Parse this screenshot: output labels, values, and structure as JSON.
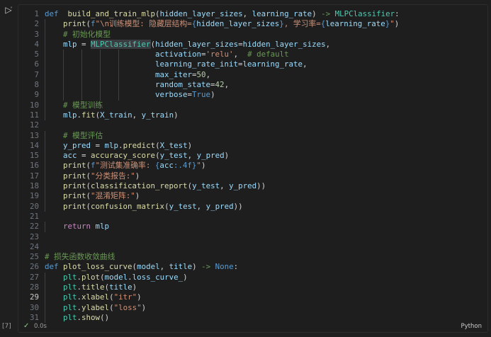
{
  "cell": {
    "run_icon": "run-icon",
    "run_glyph": "▷",
    "chevron_glyph": "˅",
    "execution_count": "[7]",
    "status_check": "✓",
    "exec_time": "0.0s",
    "language": "Python",
    "active_line": 29
  },
  "code_lines": [
    {
      "n": "1",
      "tokens": [
        [
          "kw",
          "def"
        ],
        [
          "",
          "  "
        ],
        [
          "fn",
          "build_and_train_mlp"
        ],
        [
          "",
          "("
        ],
        [
          "var",
          "hidden_layer_sizes"
        ],
        [
          "",
          ", "
        ],
        [
          "var",
          "learning_rate"
        ],
        [
          "",
          ") "
        ],
        [
          "cmt2",
          "->"
        ],
        [
          "",
          " "
        ],
        [
          "cls",
          "MLPClassifier"
        ],
        [
          "",
          ":"
        ]
      ]
    },
    {
      "n": "2",
      "tokens": [
        [
          "",
          "    "
        ],
        [
          "fn",
          "print"
        ],
        [
          "",
          "("
        ],
        [
          "kw",
          "f"
        ],
        [
          "str",
          "\""
        ],
        [
          "str",
          "\\n训练模型: 隐藏层结构="
        ],
        [
          "brace",
          "{"
        ],
        [
          "var",
          "hidden_layer_sizes"
        ],
        [
          "brace",
          "}"
        ],
        [
          "str",
          ", 学习率="
        ],
        [
          "brace",
          "{"
        ],
        [
          "var",
          "learning_rate"
        ],
        [
          "brace",
          "}"
        ],
        [
          "str",
          "\""
        ],
        [
          "",
          ")"
        ]
      ]
    },
    {
      "n": "3",
      "tokens": [
        [
          "",
          "    "
        ],
        [
          "cmt",
          "# 初始化模型"
        ]
      ]
    },
    {
      "n": "4",
      "tokens": [
        [
          "",
          "    "
        ],
        [
          "var",
          "mlp"
        ],
        [
          "",
          " = "
        ],
        [
          "clsh",
          "MLPClassifier"
        ],
        [
          "",
          "("
        ],
        [
          "var",
          "hidden_layer_sizes"
        ],
        [
          "",
          "="
        ],
        [
          "var",
          "hidden_layer_sizes"
        ],
        [
          "",
          ","
        ]
      ]
    },
    {
      "n": "5",
      "tokens": [
        [
          "",
          "                        "
        ],
        [
          "var",
          "activation"
        ],
        [
          "",
          "="
        ],
        [
          "str",
          "'relu'"
        ],
        [
          "",
          ",  "
        ],
        [
          "cmt",
          "# default"
        ]
      ]
    },
    {
      "n": "6",
      "tokens": [
        [
          "",
          "                        "
        ],
        [
          "var",
          "learning_rate_init"
        ],
        [
          "",
          "="
        ],
        [
          "var",
          "learning_rate"
        ],
        [
          "",
          ","
        ]
      ]
    },
    {
      "n": "7",
      "tokens": [
        [
          "",
          "                        "
        ],
        [
          "var",
          "max_iter"
        ],
        [
          "",
          "="
        ],
        [
          "num",
          "50"
        ],
        [
          "",
          ","
        ]
      ]
    },
    {
      "n": "8",
      "tokens": [
        [
          "",
          "                        "
        ],
        [
          "var",
          "random_state"
        ],
        [
          "",
          "="
        ],
        [
          "num",
          "42"
        ],
        [
          "",
          ","
        ]
      ]
    },
    {
      "n": "9",
      "tokens": [
        [
          "",
          "                        "
        ],
        [
          "var",
          "verbose"
        ],
        [
          "",
          "="
        ],
        [
          "kw",
          "True"
        ],
        [
          "",
          ")"
        ]
      ]
    },
    {
      "n": "10",
      "tokens": [
        [
          "",
          "    "
        ],
        [
          "cmt",
          "# 模型训练"
        ]
      ]
    },
    {
      "n": "11",
      "tokens": [
        [
          "",
          "    "
        ],
        [
          "var",
          "mlp"
        ],
        [
          "",
          "."
        ],
        [
          "fn",
          "fit"
        ],
        [
          "",
          "("
        ],
        [
          "var",
          "X_train"
        ],
        [
          "",
          ", "
        ],
        [
          "var",
          "y_train"
        ],
        [
          "",
          ")"
        ]
      ]
    },
    {
      "n": "12",
      "tokens": []
    },
    {
      "n": "13",
      "tokens": [
        [
          "",
          "    "
        ],
        [
          "cmt",
          "# 模型评估"
        ]
      ]
    },
    {
      "n": "14",
      "tokens": [
        [
          "",
          "    "
        ],
        [
          "var",
          "y_pred"
        ],
        [
          "",
          " = "
        ],
        [
          "var",
          "mlp"
        ],
        [
          "",
          "."
        ],
        [
          "fn",
          "predict"
        ],
        [
          "",
          "("
        ],
        [
          "var",
          "X_test"
        ],
        [
          "",
          ")"
        ]
      ]
    },
    {
      "n": "15",
      "tokens": [
        [
          "",
          "    "
        ],
        [
          "var",
          "acc"
        ],
        [
          "",
          " = "
        ],
        [
          "fn",
          "accuracy_score"
        ],
        [
          "",
          "("
        ],
        [
          "var",
          "y_test"
        ],
        [
          "",
          ", "
        ],
        [
          "var",
          "y_pred"
        ],
        [
          "",
          ")"
        ]
      ]
    },
    {
      "n": "16",
      "tokens": [
        [
          "",
          "    "
        ],
        [
          "fn",
          "print"
        ],
        [
          "",
          "("
        ],
        [
          "kw",
          "f"
        ],
        [
          "str",
          "\"测试集准确率: "
        ],
        [
          "brace",
          "{"
        ],
        [
          "var",
          "acc"
        ],
        [
          "kw",
          ":.4f"
        ],
        [
          "brace",
          "}"
        ],
        [
          "str",
          "\""
        ],
        [
          "",
          ")"
        ]
      ]
    },
    {
      "n": "17",
      "tokens": [
        [
          "",
          "    "
        ],
        [
          "fn",
          "print"
        ],
        [
          "",
          "("
        ],
        [
          "str",
          "\"分类报告:\""
        ],
        [
          "",
          ")"
        ]
      ]
    },
    {
      "n": "18",
      "tokens": [
        [
          "",
          "    "
        ],
        [
          "fn",
          "print"
        ],
        [
          "",
          "("
        ],
        [
          "fn",
          "classification_report"
        ],
        [
          "",
          "("
        ],
        [
          "var",
          "y_test"
        ],
        [
          "",
          ", "
        ],
        [
          "var",
          "y_pred"
        ],
        [
          "",
          "))"
        ]
      ]
    },
    {
      "n": "19",
      "tokens": [
        [
          "",
          "    "
        ],
        [
          "fn",
          "print"
        ],
        [
          "",
          "("
        ],
        [
          "str",
          "\"混淆矩阵:\""
        ],
        [
          "",
          ")"
        ]
      ]
    },
    {
      "n": "20",
      "tokens": [
        [
          "",
          "    "
        ],
        [
          "fn",
          "print"
        ],
        [
          "",
          "("
        ],
        [
          "fn",
          "confusion_matrix"
        ],
        [
          "",
          "("
        ],
        [
          "var",
          "y_test"
        ],
        [
          "",
          ", "
        ],
        [
          "var",
          "y_pred"
        ],
        [
          "",
          "))"
        ]
      ]
    },
    {
      "n": "21",
      "tokens": []
    },
    {
      "n": "22",
      "tokens": [
        [
          "",
          "    "
        ],
        [
          "kw2",
          "return"
        ],
        [
          "",
          " "
        ],
        [
          "var",
          "mlp"
        ]
      ]
    },
    {
      "n": "23",
      "tokens": []
    },
    {
      "n": "24",
      "tokens": []
    },
    {
      "n": "25",
      "tokens": [
        [
          "cmt",
          "# 损失函数收敛曲线"
        ]
      ]
    },
    {
      "n": "26",
      "tokens": [
        [
          "kw",
          "def"
        ],
        [
          "",
          " "
        ],
        [
          "fn",
          "plot_loss_curve"
        ],
        [
          "",
          "("
        ],
        [
          "var",
          "model"
        ],
        [
          "",
          ", "
        ],
        [
          "var",
          "title"
        ],
        [
          "",
          ") "
        ],
        [
          "cmt2",
          "->"
        ],
        [
          "",
          " "
        ],
        [
          "kw",
          "None"
        ],
        [
          "",
          ":"
        ]
      ]
    },
    {
      "n": "27",
      "tokens": [
        [
          "",
          "    "
        ],
        [
          "cls",
          "plt"
        ],
        [
          "",
          "."
        ],
        [
          "fn",
          "plot"
        ],
        [
          "",
          "("
        ],
        [
          "var",
          "model"
        ],
        [
          "",
          "."
        ],
        [
          "var",
          "loss_curve_"
        ],
        [
          "",
          ")"
        ]
      ]
    },
    {
      "n": "28",
      "tokens": [
        [
          "",
          "    "
        ],
        [
          "cls",
          "plt"
        ],
        [
          "",
          "."
        ],
        [
          "fn",
          "title"
        ],
        [
          "",
          "("
        ],
        [
          "var",
          "title"
        ],
        [
          "",
          ")"
        ]
      ]
    },
    {
      "n": "29",
      "tokens": [
        [
          "",
          "    "
        ],
        [
          "cls",
          "plt"
        ],
        [
          "",
          "."
        ],
        [
          "fn",
          "xlabel"
        ],
        [
          "",
          "("
        ],
        [
          "str",
          "\"itr\""
        ],
        [
          "",
          ")"
        ]
      ]
    },
    {
      "n": "30",
      "tokens": [
        [
          "",
          "    "
        ],
        [
          "cls",
          "plt"
        ],
        [
          "",
          "."
        ],
        [
          "fn",
          "ylabel"
        ],
        [
          "",
          "("
        ],
        [
          "str",
          "\"loss\""
        ],
        [
          "",
          ")"
        ]
      ]
    },
    {
      "n": "31",
      "tokens": [
        [
          "",
          "    "
        ],
        [
          "cls",
          "plt"
        ],
        [
          "",
          "."
        ],
        [
          "fn",
          "show"
        ],
        [
          "",
          "()"
        ]
      ]
    }
  ],
  "colors": {
    "background": "#1e1e1e",
    "keyword": "#569cd6",
    "function": "#dcdcaa",
    "string": "#ce9178",
    "comment": "#6a9955",
    "variable": "#9cdcfe",
    "class": "#4ec9b0",
    "number": "#b5cea8"
  }
}
